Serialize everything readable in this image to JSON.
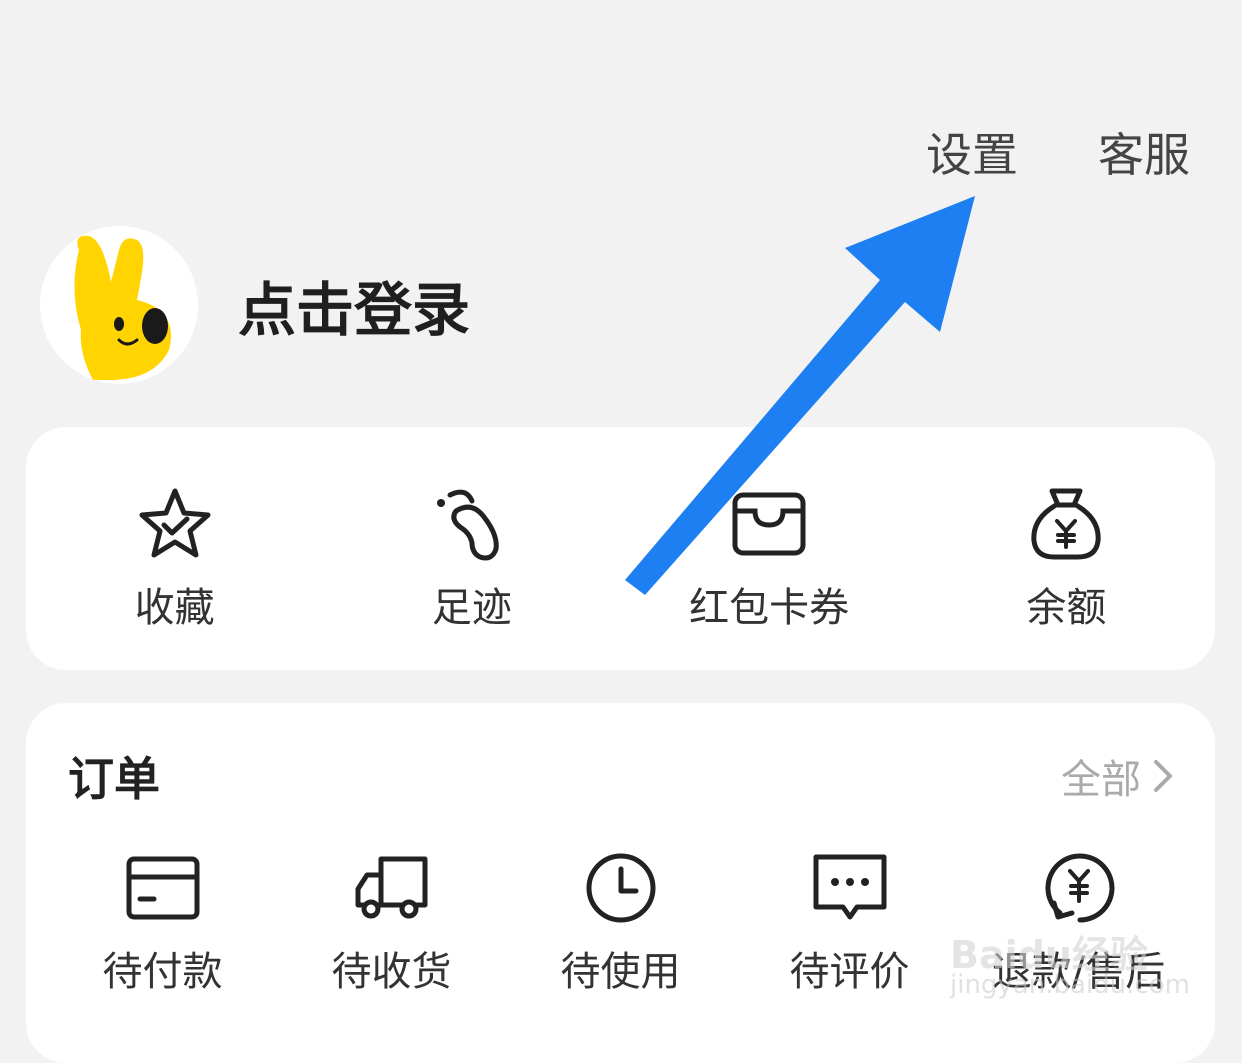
{
  "header": {
    "settings_label": "设置",
    "service_label": "客服"
  },
  "profile": {
    "login_label": "点击登录",
    "avatar_icon": "mascot-avatar-icon"
  },
  "quick_actions": [
    {
      "label": "收藏",
      "icon": "star-check-icon"
    },
    {
      "label": "足迹",
      "icon": "footprint-icon"
    },
    {
      "label": "红包卡券",
      "icon": "wallet-icon"
    },
    {
      "label": "余额",
      "icon": "money-bag-icon"
    }
  ],
  "orders": {
    "title": "订单",
    "all_label": "全部",
    "items": [
      {
        "label": "待付款",
        "icon": "card-icon"
      },
      {
        "label": "待收货",
        "icon": "truck-icon"
      },
      {
        "label": "待使用",
        "icon": "clock-icon"
      },
      {
        "label": "待评价",
        "icon": "comment-icon"
      },
      {
        "label": "退款/售后",
        "icon": "refund-icon"
      }
    ]
  },
  "watermark": {
    "line1": "Baidu经验",
    "line2": "jingyan.baidu.com"
  },
  "colors": {
    "background": "#f2f2f2",
    "card": "#ffffff",
    "arrow": "#1e7ff2",
    "mascot": "#ffd400"
  }
}
